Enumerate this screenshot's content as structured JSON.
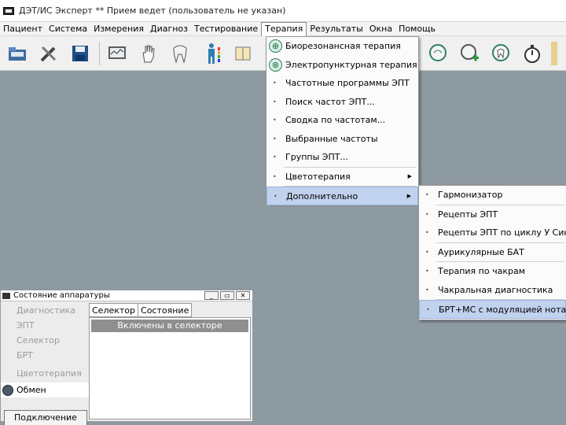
{
  "title": "ДЭТ/ИС Эксперт  ** Прием ведет (пользователь не указан)",
  "menubar": [
    "Пациент",
    "Система",
    "Измерения",
    "Диагноз",
    "Тестирование",
    "Терапия",
    "Результаты",
    "Окна",
    "Помощь"
  ],
  "toolbar_icons": [
    "open-folder-icon",
    "tools-icon",
    "save-disk-icon",
    "monitor-icon",
    "hand-icon",
    "tooth-icon",
    "body-figure-icon",
    "book-icon",
    "head-profile-icon",
    "head-add-icon",
    "head-tooth-icon",
    "stopwatch-icon"
  ],
  "therapy_menu": {
    "items": [
      {
        "label": "Биорезонансная терапия",
        "icon": "bioresonance-icon"
      },
      {
        "label": "Электропунктурная терапия",
        "icon": "electropuncture-icon"
      },
      {
        "label": "Частотные программы ЭПТ"
      },
      {
        "label": "Поиск частот ЭПТ..."
      },
      {
        "label": "Сводка по частотам..."
      },
      {
        "label": "Выбранные частоты"
      },
      {
        "label": "Группы ЭПТ..."
      },
      {
        "label": "Цветотерапия"
      },
      {
        "label": "Дополнительно"
      }
    ]
  },
  "extra_menu": {
    "items": [
      {
        "label": "Гармонизатор"
      },
      {
        "label": "Рецепты ЭПТ"
      },
      {
        "label": "Рецепты ЭПТ по циклу У Син"
      },
      {
        "label": "Аурикулярные БАТ"
      },
      {
        "label": "Терапия по чакрам"
      },
      {
        "label": "Чакральная диагностика"
      },
      {
        "label": "БРТ+МС с модуляцией нотами"
      }
    ]
  },
  "hardware_panel": {
    "title": "Состояние аппаратуры",
    "left_items": [
      "Диагностика",
      "ЭПТ",
      "Селектор",
      "БРТ",
      "Цветотерапия"
    ],
    "exchange": "Обмен",
    "connect_button": "Подключение",
    "tabs": [
      "Селектор",
      "Состояние"
    ],
    "content_header": "Включены в селекторе"
  }
}
